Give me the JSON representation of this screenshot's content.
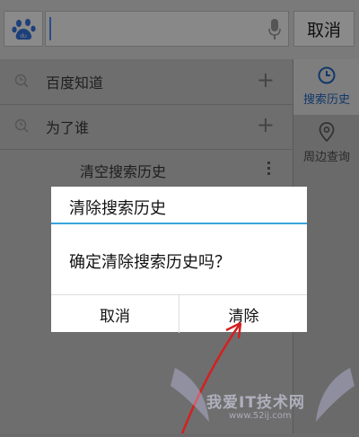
{
  "top_bar": {
    "logo_icon": "baidu-paw-icon",
    "search_placeholder": "",
    "mic_icon": "microphone-icon",
    "cancel_label": "取消"
  },
  "history": {
    "items": [
      {
        "label": "百度知道",
        "icon": "clock-search-icon",
        "action_icon": "plus-icon"
      },
      {
        "label": "为了谁",
        "icon": "clock-search-icon",
        "action_icon": "plus-icon"
      }
    ],
    "clear_label": "清空搜索历史",
    "menu_icon": "vertical-dots-icon"
  },
  "side_panel": {
    "history_label": "搜索历史",
    "nearby_label": "周边查询",
    "active_color": "#12386b"
  },
  "dialog": {
    "title": "清除搜索历史",
    "message": "确定清除搜索历史吗？",
    "cancel_label": "取消",
    "confirm_label": "清除",
    "accent_color": "#39a5dc"
  },
  "annotation": {
    "arrow_color": "#d42020"
  },
  "watermark": {
    "text": "我爱IT技术网",
    "url": "www.52ij.com"
  }
}
